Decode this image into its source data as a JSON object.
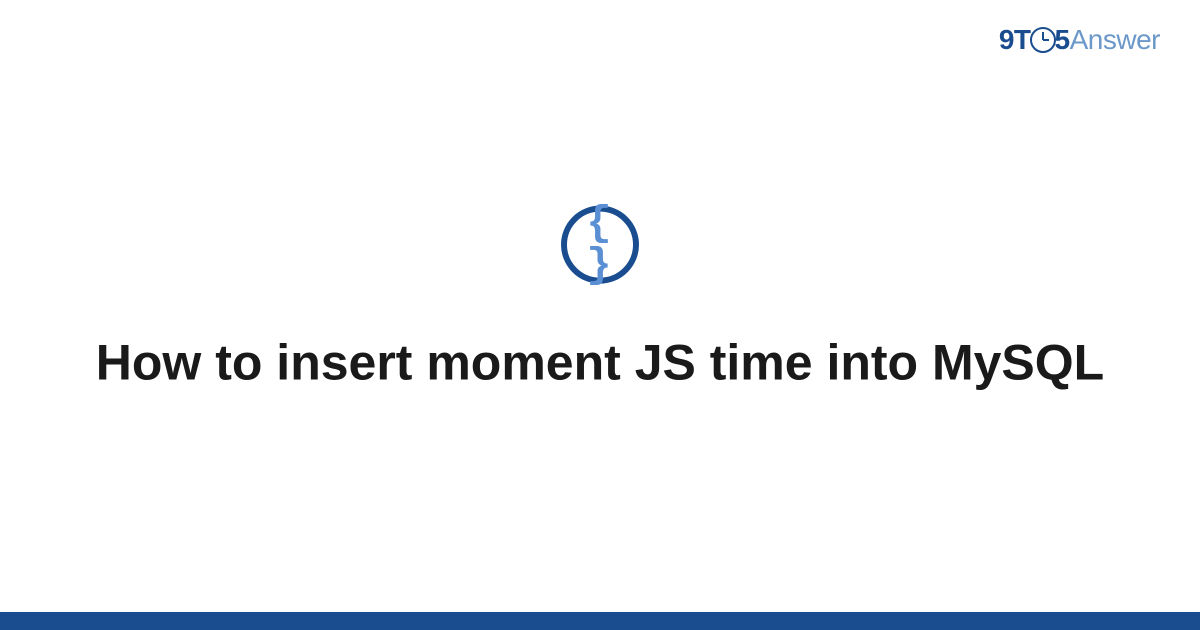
{
  "logo": {
    "part1": "9T",
    "part2": "5",
    "part3": "Answer"
  },
  "icon": {
    "symbol": "{ }"
  },
  "title": "How to insert moment JS time into MySQL"
}
